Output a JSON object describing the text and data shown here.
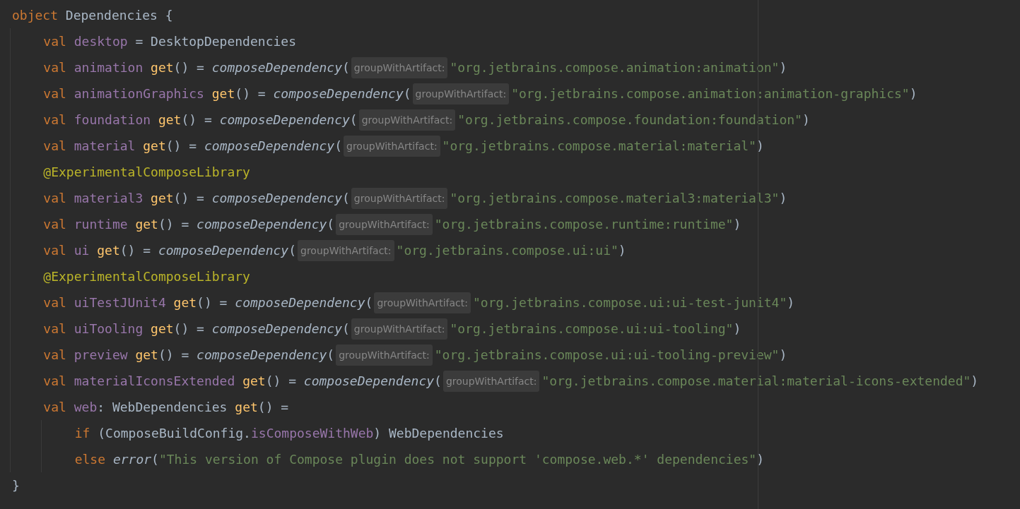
{
  "editor": {
    "lines": [
      {
        "tokens": [
          {
            "kind": "keyword",
            "text": "object "
          },
          {
            "kind": "plain",
            "text": "Dependencies {"
          }
        ],
        "children": [
          {
            "tokens": [
              {
                "kind": "keyword",
                "text": "val "
              },
              {
                "kind": "property",
                "text": "desktop"
              },
              {
                "kind": "plain",
                "text": " = DesktopDependencies"
              }
            ]
          },
          {
            "tokens": [
              {
                "kind": "keyword",
                "text": "val "
              },
              {
                "kind": "property",
                "text": "animation "
              },
              {
                "kind": "function",
                "text": "get"
              },
              {
                "kind": "plain",
                "text": "() = "
              },
              {
                "kind": "call",
                "text": "composeDependency"
              },
              {
                "kind": "plain",
                "text": "("
              },
              {
                "kind": "hint",
                "text": "groupWithArtifact:"
              },
              {
                "kind": "string",
                "text": "\"org.jetbrains.compose.animation:animation\""
              },
              {
                "kind": "plain",
                "text": ")"
              }
            ]
          },
          {
            "tokens": [
              {
                "kind": "keyword",
                "text": "val "
              },
              {
                "kind": "property",
                "text": "animationGraphics "
              },
              {
                "kind": "function",
                "text": "get"
              },
              {
                "kind": "plain",
                "text": "() = "
              },
              {
                "kind": "call",
                "text": "composeDependency"
              },
              {
                "kind": "plain",
                "text": "("
              },
              {
                "kind": "hint",
                "text": "groupWithArtifact:"
              },
              {
                "kind": "string",
                "text": "\"org.jetbrains.compose.animation:animation-graphics\""
              },
              {
                "kind": "plain",
                "text": ")"
              }
            ]
          },
          {
            "tokens": [
              {
                "kind": "keyword",
                "text": "val "
              },
              {
                "kind": "property",
                "text": "foundation "
              },
              {
                "kind": "function",
                "text": "get"
              },
              {
                "kind": "plain",
                "text": "() = "
              },
              {
                "kind": "call",
                "text": "composeDependency"
              },
              {
                "kind": "plain",
                "text": "("
              },
              {
                "kind": "hint",
                "text": "groupWithArtifact:"
              },
              {
                "kind": "string",
                "text": "\"org.jetbrains.compose.foundation:foundation\""
              },
              {
                "kind": "plain",
                "text": ")"
              }
            ]
          },
          {
            "tokens": [
              {
                "kind": "keyword",
                "text": "val "
              },
              {
                "kind": "property",
                "text": "material "
              },
              {
                "kind": "function",
                "text": "get"
              },
              {
                "kind": "plain",
                "text": "() = "
              },
              {
                "kind": "call",
                "text": "composeDependency"
              },
              {
                "kind": "plain",
                "text": "("
              },
              {
                "kind": "hint",
                "text": "groupWithArtifact:"
              },
              {
                "kind": "string",
                "text": "\"org.jetbrains.compose.material:material\""
              },
              {
                "kind": "plain",
                "text": ")"
              }
            ]
          },
          {
            "tokens": [
              {
                "kind": "annotation",
                "text": "@ExperimentalComposeLibrary"
              }
            ]
          },
          {
            "tokens": [
              {
                "kind": "keyword",
                "text": "val "
              },
              {
                "kind": "property",
                "text": "material3 "
              },
              {
                "kind": "function",
                "text": "get"
              },
              {
                "kind": "plain",
                "text": "() = "
              },
              {
                "kind": "call",
                "text": "composeDependency"
              },
              {
                "kind": "plain",
                "text": "("
              },
              {
                "kind": "hint",
                "text": "groupWithArtifact:"
              },
              {
                "kind": "string",
                "text": "\"org.jetbrains.compose.material3:material3\""
              },
              {
                "kind": "plain",
                "text": ")"
              }
            ]
          },
          {
            "tokens": [
              {
                "kind": "keyword",
                "text": "val "
              },
              {
                "kind": "property",
                "text": "runtime "
              },
              {
                "kind": "function",
                "text": "get"
              },
              {
                "kind": "plain",
                "text": "() = "
              },
              {
                "kind": "call",
                "text": "composeDependency"
              },
              {
                "kind": "plain",
                "text": "("
              },
              {
                "kind": "hint",
                "text": "groupWithArtifact:"
              },
              {
                "kind": "string",
                "text": "\"org.jetbrains.compose.runtime:runtime\""
              },
              {
                "kind": "plain",
                "text": ")"
              }
            ]
          },
          {
            "tokens": [
              {
                "kind": "keyword",
                "text": "val "
              },
              {
                "kind": "property",
                "text": "ui "
              },
              {
                "kind": "function",
                "text": "get"
              },
              {
                "kind": "plain",
                "text": "() = "
              },
              {
                "kind": "call",
                "text": "composeDependency"
              },
              {
                "kind": "plain",
                "text": "("
              },
              {
                "kind": "hint",
                "text": "groupWithArtifact:"
              },
              {
                "kind": "string",
                "text": "\"org.jetbrains.compose.ui:ui\""
              },
              {
                "kind": "plain",
                "text": ")"
              }
            ]
          },
          {
            "tokens": [
              {
                "kind": "annotation",
                "text": "@ExperimentalComposeLibrary"
              }
            ]
          },
          {
            "tokens": [
              {
                "kind": "keyword",
                "text": "val "
              },
              {
                "kind": "property",
                "text": "uiTestJUnit4 "
              },
              {
                "kind": "function",
                "text": "get"
              },
              {
                "kind": "plain",
                "text": "() = "
              },
              {
                "kind": "call",
                "text": "composeDependency"
              },
              {
                "kind": "plain",
                "text": "("
              },
              {
                "kind": "hint",
                "text": "groupWithArtifact:"
              },
              {
                "kind": "string",
                "text": "\"org.jetbrains.compose.ui:ui-test-junit4\""
              },
              {
                "kind": "plain",
                "text": ")"
              }
            ]
          },
          {
            "tokens": [
              {
                "kind": "keyword",
                "text": "val "
              },
              {
                "kind": "property",
                "text": "uiTooling "
              },
              {
                "kind": "function",
                "text": "get"
              },
              {
                "kind": "plain",
                "text": "() = "
              },
              {
                "kind": "call",
                "text": "composeDependency"
              },
              {
                "kind": "plain",
                "text": "("
              },
              {
                "kind": "hint",
                "text": "groupWithArtifact:"
              },
              {
                "kind": "string",
                "text": "\"org.jetbrains.compose.ui:ui-tooling\""
              },
              {
                "kind": "plain",
                "text": ")"
              }
            ]
          },
          {
            "tokens": [
              {
                "kind": "keyword",
                "text": "val "
              },
              {
                "kind": "property",
                "text": "preview "
              },
              {
                "kind": "function",
                "text": "get"
              },
              {
                "kind": "plain",
                "text": "() = "
              },
              {
                "kind": "call",
                "text": "composeDependency"
              },
              {
                "kind": "plain",
                "text": "("
              },
              {
                "kind": "hint",
                "text": "groupWithArtifact:"
              },
              {
                "kind": "string",
                "text": "\"org.jetbrains.compose.ui:ui-tooling-preview\""
              },
              {
                "kind": "plain",
                "text": ")"
              }
            ]
          },
          {
            "tokens": [
              {
                "kind": "keyword",
                "text": "val "
              },
              {
                "kind": "property",
                "text": "materialIconsExtended "
              },
              {
                "kind": "function",
                "text": "get"
              },
              {
                "kind": "plain",
                "text": "() = "
              },
              {
                "kind": "call",
                "text": "composeDependency"
              },
              {
                "kind": "plain",
                "text": "("
              },
              {
                "kind": "hint",
                "text": "groupWithArtifact:"
              },
              {
                "kind": "string",
                "text": "\"org.jetbrains.compose.material:material-icons-extended\""
              },
              {
                "kind": "plain",
                "text": ")"
              }
            ]
          },
          {
            "tokens": [
              {
                "kind": "keyword",
                "text": "val "
              },
              {
                "kind": "property",
                "text": "web"
              },
              {
                "kind": "plain",
                "text": ": WebDependencies "
              },
              {
                "kind": "function",
                "text": "get"
              },
              {
                "kind": "plain",
                "text": "() ="
              }
            ],
            "children": [
              {
                "tokens": [
                  {
                    "kind": "keyword",
                    "text": "if "
                  },
                  {
                    "kind": "plain",
                    "text": "(ComposeBuildConfig."
                  },
                  {
                    "kind": "property",
                    "text": "isComposeWithWeb"
                  },
                  {
                    "kind": "plain",
                    "text": ") WebDependencies"
                  }
                ]
              },
              {
                "tokens": [
                  {
                    "kind": "keyword",
                    "text": "else "
                  },
                  {
                    "kind": "call",
                    "text": "error"
                  },
                  {
                    "kind": "plain",
                    "text": "("
                  },
                  {
                    "kind": "string",
                    "text": "\"This version of Compose plugin does not support 'compose.web.*' dependencies\""
                  },
                  {
                    "kind": "plain",
                    "text": ")"
                  }
                ]
              }
            ]
          }
        ]
      },
      {
        "tokens": [
          {
            "kind": "plain",
            "text": "}"
          }
        ]
      }
    ]
  }
}
